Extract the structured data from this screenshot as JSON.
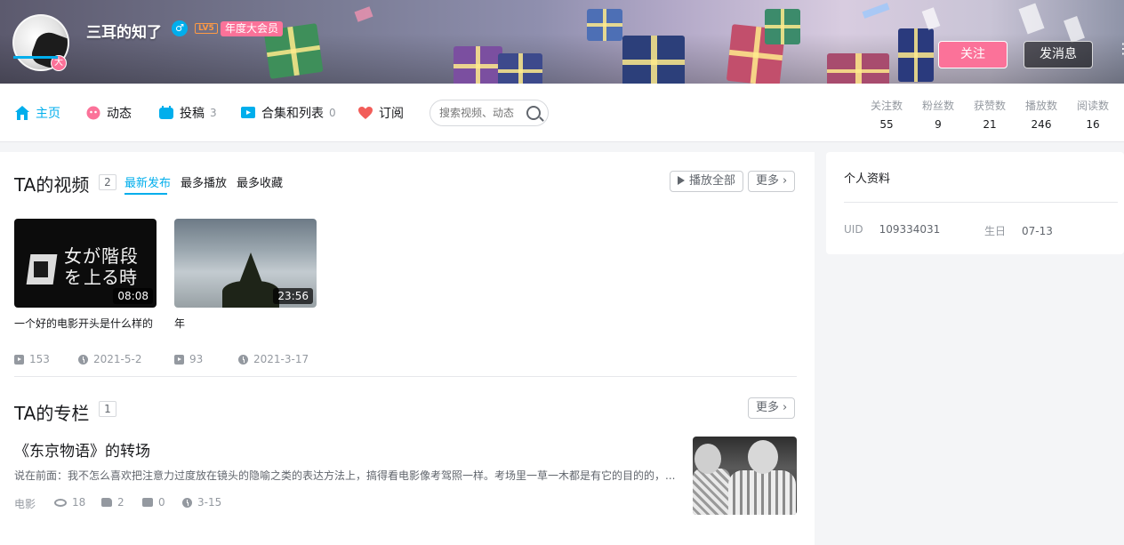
{
  "profile": {
    "username": "三耳的知了",
    "gender_icon": "male-icon",
    "level": "LV5",
    "vip_label": "年度大会员",
    "avatar_badge": "大",
    "follow_label": "关注",
    "message_label": "发消息"
  },
  "nav": {
    "items": [
      {
        "label": "主页",
        "count": "",
        "icon": "home-icon"
      },
      {
        "label": "动态",
        "count": "",
        "icon": "dynamic-icon"
      },
      {
        "label": "投稿",
        "count": "3",
        "icon": "upload-icon"
      },
      {
        "label": "合集和列表",
        "count": "0",
        "icon": "collection-icon"
      },
      {
        "label": "订阅",
        "count": "",
        "icon": "heart-icon"
      }
    ],
    "search_placeholder": "搜索视频、动态",
    "stats": [
      {
        "label": "关注数",
        "value": "55"
      },
      {
        "label": "粉丝数",
        "value": "9"
      },
      {
        "label": "获赞数",
        "value": "21"
      },
      {
        "label": "播放数",
        "value": "246"
      },
      {
        "label": "阅读数",
        "value": "16"
      }
    ]
  },
  "videos": {
    "title": "TA的视频",
    "count": "2",
    "tabs": [
      "最新发布",
      "最多播放",
      "最多收藏"
    ],
    "play_all_label": "播放全部",
    "more_label": "更多",
    "items": [
      {
        "title": "一个好的电影开头是什么样的",
        "duration": "08:08",
        "plays": "153",
        "date": "2021-5-2",
        "thumb_text_1": "女が階段を",
        "thumb_text_2": "上る時"
      },
      {
        "title": "年",
        "duration": "23:56",
        "plays": "93",
        "date": "2021-3-17"
      }
    ]
  },
  "articles": {
    "title": "TA的专栏",
    "count": "1",
    "more_label": "更多",
    "items": [
      {
        "title": "《东京物语》的转场",
        "desc": "说在前面：我不怎么喜欢把注意力过度放在镜头的隐喻之类的表达方法上，搞得看电影像考驾照一样。考场里一草一木都是有它的目的的，...",
        "category": "电影",
        "views": "18",
        "likes": "2",
        "comments": "0",
        "date": "3-15"
      }
    ]
  },
  "side": {
    "title": "个人资料",
    "uid_label": "UID",
    "uid_value": "109334031",
    "birthday_label": "生日",
    "birthday_value": "07-13"
  },
  "colors": {
    "accent": "#00aeec",
    "pink": "#fb7299",
    "muted": "#9499a0"
  }
}
